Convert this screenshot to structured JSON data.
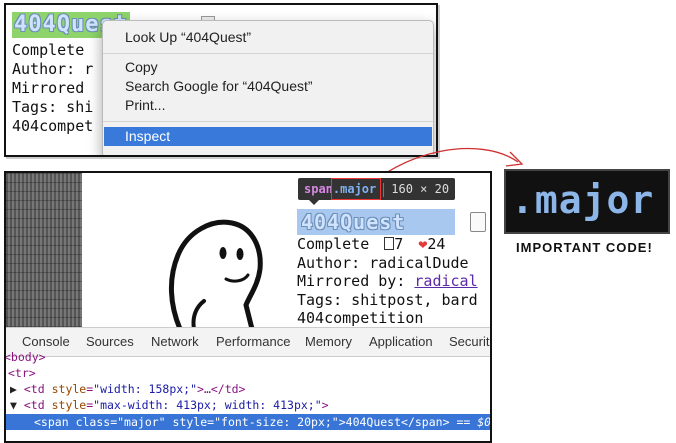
{
  "top": {
    "title": "404Quest",
    "lines": [
      "Complete",
      "Author: r",
      "Mirrored",
      "Tags: shi",
      "404compet"
    ],
    "context_menu": {
      "items": [
        "Look Up “404Quest”",
        "Copy",
        "Search Google for “404Quest”",
        "Print...",
        "Inspect"
      ],
      "active_item": "Inspect"
    }
  },
  "callout": {
    "code": ".major",
    "caption": "IMPORTANT CODE!"
  },
  "bottom": {
    "tooltip": {
      "tag": "span",
      "cls": ".major",
      "size": "160 × 20"
    },
    "title": "404Quest",
    "complete_label": "Complete",
    "copy_count": "7",
    "like_count": "24",
    "author_line": "Author: radicalDude",
    "mirrored_label": "Mirrored by:",
    "mirrored_link": "radical",
    "tags_line": "Tags: shitpost, bard",
    "last_line": "404competition"
  },
  "devtools": {
    "tabs": [
      "Console",
      "Sources",
      "Network",
      "Performance",
      "Memory",
      "Application",
      "Securit"
    ],
    "code": {
      "l0": "<body>",
      "l1": "<tr>",
      "l2a_tag": "<td",
      "l2a_attr": "style",
      "l2a_val": "\"width: 158px;\"",
      "l2a_rest": ">…</td>",
      "l3_tag": "<td",
      "l3_attr": "style",
      "l3_val": "\"max-width: 413px; width: 413px;\"",
      "l3_rest": ">",
      "l4_open": "<span",
      "l4_class_attr": "class",
      "l4_class_val": "\"major\"",
      "l4_style_attr": "style",
      "l4_style_val": "\"font-size: 20px;\"",
      "l4_text": ">404Quest</span>",
      "l4_marker": "== $0"
    }
  },
  "colors": {
    "menu_highlight": "#3879d9",
    "callout_bg": "#111111",
    "callout_text": "#8cb5e8",
    "like_heart": "#e23b3b",
    "link": "#5b2aa8"
  }
}
